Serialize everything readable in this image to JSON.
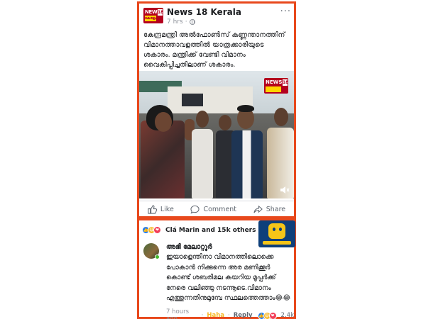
{
  "post": {
    "page_name": "News 18 Kerala",
    "time": "7 hrs",
    "separator": "·",
    "more_glyph": "···",
    "logo": {
      "line1": "NEWS",
      "line2": "കേരളം",
      "badge": "18"
    },
    "text": "കേന്ദ്രമന്ത്രി അൽഫോൺസ് കണ്ണന്താനത്തിന് വിമാനത്താവളത്തിൽ യാത്രക്കാരിയുടെ ശകാരം. മന്ത്രിക്ക് വേണ്ടി വിമാനം വൈകിപ്പിച്ചതിലാണ് ശകാരം.",
    "video": {
      "channel_logo_text": "NEWS",
      "channel_logo_badge": "18"
    },
    "actions": {
      "like": "Like",
      "comment": "Comment",
      "share": "Share"
    }
  },
  "reactions": {
    "summary": "Clá Marin and 15k others",
    "icons": [
      "like-icon",
      "haha-icon",
      "love-icon"
    ]
  },
  "comment": {
    "author": "അഭി മേലാറ്റൂർ",
    "text": "ഇയാളെന്തിനാ വിമാനത്തിലൊക്കെ പോകാൻ നിക്കുന്നെ അര മണിക്കൂർ കൊണ്ട് ശബരിമല കയറിയ മൂപ്പർക്ക് നേരെ വലിഞ്ഞു നടന്നൂടെ.വിമാനം എത്തുന്നതിനുമുമ്പേ സ്ഥലത്തെത്താം😂😂",
    "time": "7 hours ago",
    "dot": "·",
    "haha": "Haha",
    "reply": "Reply",
    "reaction_count": "2.4k"
  },
  "colors": {
    "frame_border": "#e8481c",
    "facebook_blue": "#1877f2",
    "haha_yellow": "#f7b928",
    "love_red": "#f33e58",
    "news18_red": "#b4001e"
  }
}
